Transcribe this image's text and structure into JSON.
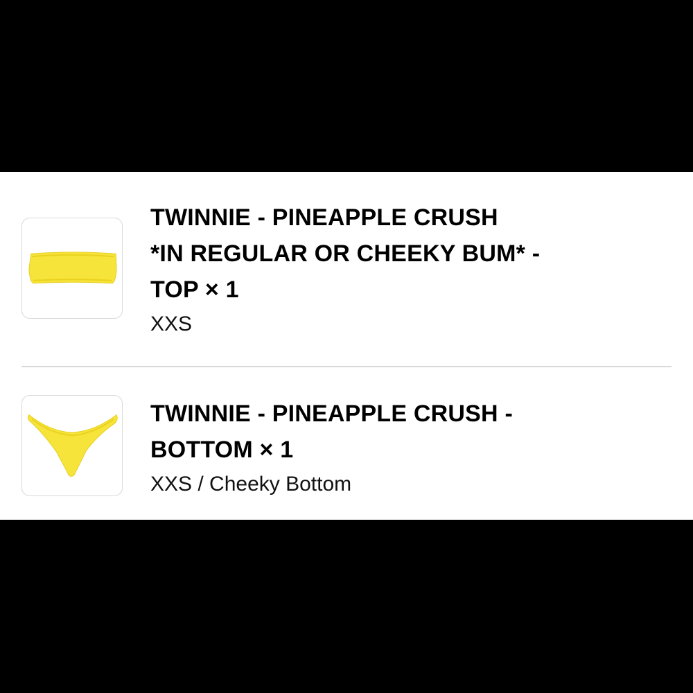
{
  "colors": {
    "background_band": "#000000",
    "panel": "#ffffff",
    "product_yellow": "#f7e43a",
    "divider": "#d9d9d9",
    "text": "#000000"
  },
  "order_items": [
    {
      "title": "TWINNIE - PINEAPPLE CRUSH *IN REGULAR OR CHEEKY BUM* - TOP",
      "quantity_label": "× 1",
      "title_lines": [
        "TWINNIE - PINEAPPLE CRUSH",
        "*IN REGULAR OR CHEEKY BUM* -",
        "TOP × 1"
      ],
      "variant": "XXS",
      "thumbnail_icon": "bandeau-top-image"
    },
    {
      "title": "TWINNIE - PINEAPPLE CRUSH - BOTTOM",
      "quantity_label": "× 1",
      "title_lines": [
        "TWINNIE - PINEAPPLE CRUSH -",
        "BOTTOM × 1"
      ],
      "variant": "XXS / Cheeky Bottom",
      "thumbnail_icon": "bikini-bottom-image"
    }
  ]
}
